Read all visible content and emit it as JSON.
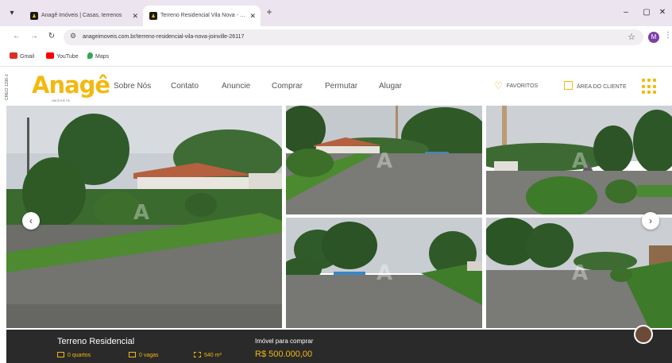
{
  "browser": {
    "tabs": [
      {
        "title": "Anagê Imóveis | Casas, terrenos",
        "active": false
      },
      {
        "title": "Terreno Residencial Vila Nova - Joinville",
        "active": true
      }
    ],
    "new_tab": "+",
    "url": "anageimoveis.com.br/terreno-residencial-vila-nova-joinville-26117",
    "profile_initial": "M",
    "bookmarks": [
      {
        "label": "Gmail",
        "color": "#d93025"
      },
      {
        "label": "YouTube",
        "color": "#ff0000"
      },
      {
        "label": "Maps",
        "color": "#34a853"
      }
    ]
  },
  "site": {
    "creci": "CRECI 1336-J",
    "logo": {
      "word": "Anagê",
      "sub": "IMÓVEIS"
    },
    "nav": [
      "Sobre Nós",
      "Contato",
      "Anuncie",
      "Comprar",
      "Permutar",
      "Alugar"
    ],
    "favorites": "FAVORITOS",
    "client_area": "ÁREA DO CLIENTE",
    "brand_color": "#f2b90f"
  },
  "gallery": {
    "watermark": "A",
    "prev_icon": "‹",
    "next_icon": "›"
  },
  "listing": {
    "type": "Terreno Residencial",
    "bedrooms": "0 quartos",
    "parking": "0 vagas",
    "area": "540 m²",
    "purpose": "Imóvel para comprar",
    "price": "R$ 500.000,00"
  }
}
